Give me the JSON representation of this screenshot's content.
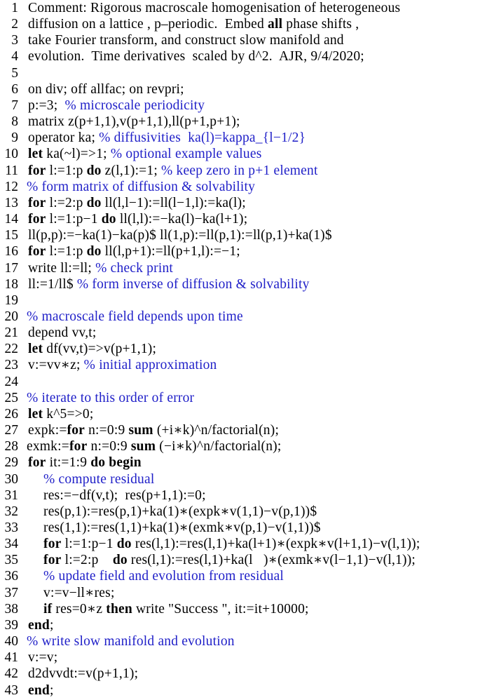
{
  "listing": {
    "comment_color": "#1f1fc8",
    "lines": [
      {
        "n": "1",
        "indent": 0,
        "parts": [
          {
            "t": "Comment: Rigorous macroscale homogenisation of heterogeneous",
            "s": "code"
          }
        ]
      },
      {
        "n": "2",
        "indent": 0,
        "parts": [
          {
            "t": "diffusion on a lattice , p–periodic.  Embed ",
            "s": "code"
          },
          {
            "t": "all",
            "s": "kw"
          },
          {
            "t": " phase shifts ,",
            "s": "code"
          }
        ]
      },
      {
        "n": "3",
        "indent": 0,
        "parts": [
          {
            "t": "take Fourier transform, and construct slow manifold and",
            "s": "code"
          }
        ]
      },
      {
        "n": "4",
        "indent": 0,
        "parts": [
          {
            "t": "evolution.  Time derivatives  scaled by d^2.  AJR, 9/4/2020;",
            "s": "code"
          }
        ]
      },
      {
        "n": "5",
        "indent": 0,
        "parts": []
      },
      {
        "n": "6",
        "indent": 0,
        "parts": [
          {
            "t": "on div; off allfac; on revpri;",
            "s": "code"
          }
        ]
      },
      {
        "n": "7",
        "indent": 0,
        "parts": [
          {
            "t": "p:=3;  ",
            "s": "code"
          },
          {
            "t": "% microscale periodicity",
            "s": "cm"
          }
        ]
      },
      {
        "n": "8",
        "indent": 0,
        "parts": [
          {
            "t": "matrix z(p+1,1),v(p+1,1),ll(p+1,p+1);",
            "s": "code"
          }
        ]
      },
      {
        "n": "9",
        "indent": 0,
        "parts": [
          {
            "t": "operator ka; ",
            "s": "code"
          },
          {
            "t": "% diffusivities  ka(l)=kappa_{l−1/2}",
            "s": "cm"
          }
        ]
      },
      {
        "n": "10",
        "indent": 0,
        "parts": [
          {
            "t": "let",
            "s": "kw"
          },
          {
            "t": " ka(~l)=>1; ",
            "s": "code"
          },
          {
            "t": "% optional example values",
            "s": "cm"
          }
        ]
      },
      {
        "n": "11",
        "indent": 0,
        "parts": [
          {
            "t": "for",
            "s": "kw"
          },
          {
            "t": " l:=1:p ",
            "s": "code"
          },
          {
            "t": "do",
            "s": "kw"
          },
          {
            "t": " z(l,1):=1; ",
            "s": "code"
          },
          {
            "t": "% keep zero in p+1 element",
            "s": "cm"
          }
        ]
      },
      {
        "n": "12",
        "indent": -1,
        "parts": [
          {
            "t": "% form matrix of diffusion & solvability",
            "s": "cm"
          }
        ]
      },
      {
        "n": "13",
        "indent": 0,
        "parts": [
          {
            "t": "for",
            "s": "kw"
          },
          {
            "t": " l:=2:p ",
            "s": "code"
          },
          {
            "t": "do",
            "s": "kw"
          },
          {
            "t": " ll(l,l−1):=ll(l−1,l):=ka(l);",
            "s": "code"
          }
        ]
      },
      {
        "n": "14",
        "indent": 0,
        "parts": [
          {
            "t": "for",
            "s": "kw"
          },
          {
            "t": " l:=1:p−1 ",
            "s": "code"
          },
          {
            "t": "do",
            "s": "kw"
          },
          {
            "t": " ll(l,l):=−ka(l)−ka(l+1);",
            "s": "code"
          }
        ]
      },
      {
        "n": "15",
        "indent": 0,
        "parts": [
          {
            "t": "ll(p,p):=−ka(1)−ka(p)$ ll(1,p):=ll(p,1):=ll(p,1)+ka(1)$",
            "s": "code"
          }
        ]
      },
      {
        "n": "16",
        "indent": 0,
        "parts": [
          {
            "t": "for",
            "s": "kw"
          },
          {
            "t": " l:=1:p ",
            "s": "code"
          },
          {
            "t": "do",
            "s": "kw"
          },
          {
            "t": " ll(l,p+1):=ll(p+1,l):=−1;",
            "s": "code"
          }
        ]
      },
      {
        "n": "17",
        "indent": 0,
        "parts": [
          {
            "t": "write ll:=ll; ",
            "s": "code"
          },
          {
            "t": "% check print",
            "s": "cm"
          }
        ]
      },
      {
        "n": "18",
        "indent": 0,
        "parts": [
          {
            "t": "ll:=1/ll$ ",
            "s": "code"
          },
          {
            "t": "% form inverse of diffusion & solvability",
            "s": "cm"
          }
        ]
      },
      {
        "n": "19",
        "indent": 0,
        "parts": []
      },
      {
        "n": "20",
        "indent": -1,
        "parts": [
          {
            "t": "% macroscale field depends upon time",
            "s": "cm"
          }
        ]
      },
      {
        "n": "21",
        "indent": 0,
        "parts": [
          {
            "t": "depend vv,t;",
            "s": "code"
          }
        ]
      },
      {
        "n": "22",
        "indent": 0,
        "parts": [
          {
            "t": "let",
            "s": "kw"
          },
          {
            "t": " df(vv,t)=>v(p+1,1);",
            "s": "code"
          }
        ]
      },
      {
        "n": "23",
        "indent": 0,
        "parts": [
          {
            "t": "v:=vv∗z; ",
            "s": "code"
          },
          {
            "t": "% initial approximation",
            "s": "cm"
          }
        ]
      },
      {
        "n": "24",
        "indent": 0,
        "parts": []
      },
      {
        "n": "25",
        "indent": -1,
        "parts": [
          {
            "t": "% iterate to this order of error",
            "s": "cm"
          }
        ]
      },
      {
        "n": "26",
        "indent": 0,
        "parts": [
          {
            "t": "let",
            "s": "kw"
          },
          {
            "t": " k^5=>0;",
            "s": "code"
          }
        ]
      },
      {
        "n": "27",
        "indent": 0,
        "parts": [
          {
            "t": "expk:=",
            "s": "code"
          },
          {
            "t": "for",
            "s": "kw"
          },
          {
            "t": " n:=0:9 ",
            "s": "code"
          },
          {
            "t": "sum",
            "s": "kw"
          },
          {
            "t": " (+i∗k)^n/factorial(n);",
            "s": "code"
          }
        ]
      },
      {
        "n": "28",
        "indent": -1,
        "parts": [
          {
            "t": "exmk:=",
            "s": "code"
          },
          {
            "t": "for",
            "s": "kw"
          },
          {
            "t": " n:=0:9 ",
            "s": "code"
          },
          {
            "t": "sum",
            "s": "kw"
          },
          {
            "t": " (−i∗k)^n/factorial(n);",
            "s": "code"
          }
        ]
      },
      {
        "n": "29",
        "indent": 0,
        "parts": [
          {
            "t": "for",
            "s": "kw"
          },
          {
            "t": " it:=1:9 ",
            "s": "code"
          },
          {
            "t": "do begin",
            "s": "kw"
          }
        ]
      },
      {
        "n": "30",
        "indent": 1,
        "parts": [
          {
            "t": "% compute residual",
            "s": "cm"
          }
        ]
      },
      {
        "n": "31",
        "indent": 1,
        "parts": [
          {
            "t": "res:=−df(v,t);  res(p+1,1):=0;",
            "s": "code"
          }
        ]
      },
      {
        "n": "32",
        "indent": 1,
        "parts": [
          {
            "t": "res(p,1):=res(p,1)+ka(1)∗(expk∗v(1,1)−v(p,1))$",
            "s": "code"
          }
        ]
      },
      {
        "n": "33",
        "indent": 1,
        "parts": [
          {
            "t": "res(1,1):=res(1,1)+ka(1)∗(exmk∗v(p,1)−v(1,1))$",
            "s": "code"
          }
        ]
      },
      {
        "n": "34",
        "indent": 1,
        "parts": [
          {
            "t": "for",
            "s": "kw"
          },
          {
            "t": " l:=1:p−1 ",
            "s": "code"
          },
          {
            "t": "do",
            "s": "kw"
          },
          {
            "t": " res(l,1):=res(l,1)+ka(l+1)∗(expk∗v(l+1,1)−v(l,1));",
            "s": "code"
          }
        ]
      },
      {
        "n": "35",
        "indent": 1,
        "parts": [
          {
            "t": "for",
            "s": "kw"
          },
          {
            "t": " l:=2:p    ",
            "s": "code"
          },
          {
            "t": "do",
            "s": "kw"
          },
          {
            "t": " res(l,1):=res(l,1)+ka(l   )∗(exmk∗v(l−1,1)−v(l,1));",
            "s": "code"
          }
        ]
      },
      {
        "n": "36",
        "indent": 1,
        "parts": [
          {
            "t": "% update field and evolution from residual",
            "s": "cm"
          }
        ]
      },
      {
        "n": "37",
        "indent": 1,
        "parts": [
          {
            "t": "v:=v−ll∗res;",
            "s": "code"
          }
        ]
      },
      {
        "n": "38",
        "indent": 1,
        "parts": [
          {
            "t": "if",
            "s": "kw"
          },
          {
            "t": " res=0∗z ",
            "s": "code"
          },
          {
            "t": "then",
            "s": "kw"
          },
          {
            "t": " write \"Success \", it:=it+10000;",
            "s": "code"
          }
        ]
      },
      {
        "n": "39",
        "indent": 0,
        "parts": [
          {
            "t": "end",
            "s": "kw"
          },
          {
            "t": ";",
            "s": "code"
          }
        ]
      },
      {
        "n": "40",
        "indent": -1,
        "parts": [
          {
            "t": "% write slow manifold and evolution",
            "s": "cm"
          }
        ]
      },
      {
        "n": "41",
        "indent": 0,
        "parts": [
          {
            "t": "v:=v;",
            "s": "code"
          }
        ]
      },
      {
        "n": "42",
        "indent": 0,
        "parts": [
          {
            "t": "d2dvvdt:=v(p+1,1);",
            "s": "code"
          }
        ]
      },
      {
        "n": "43",
        "indent": 0,
        "parts": [
          {
            "t": "end",
            "s": "kw"
          },
          {
            "t": ";",
            "s": "code"
          }
        ]
      }
    ]
  }
}
